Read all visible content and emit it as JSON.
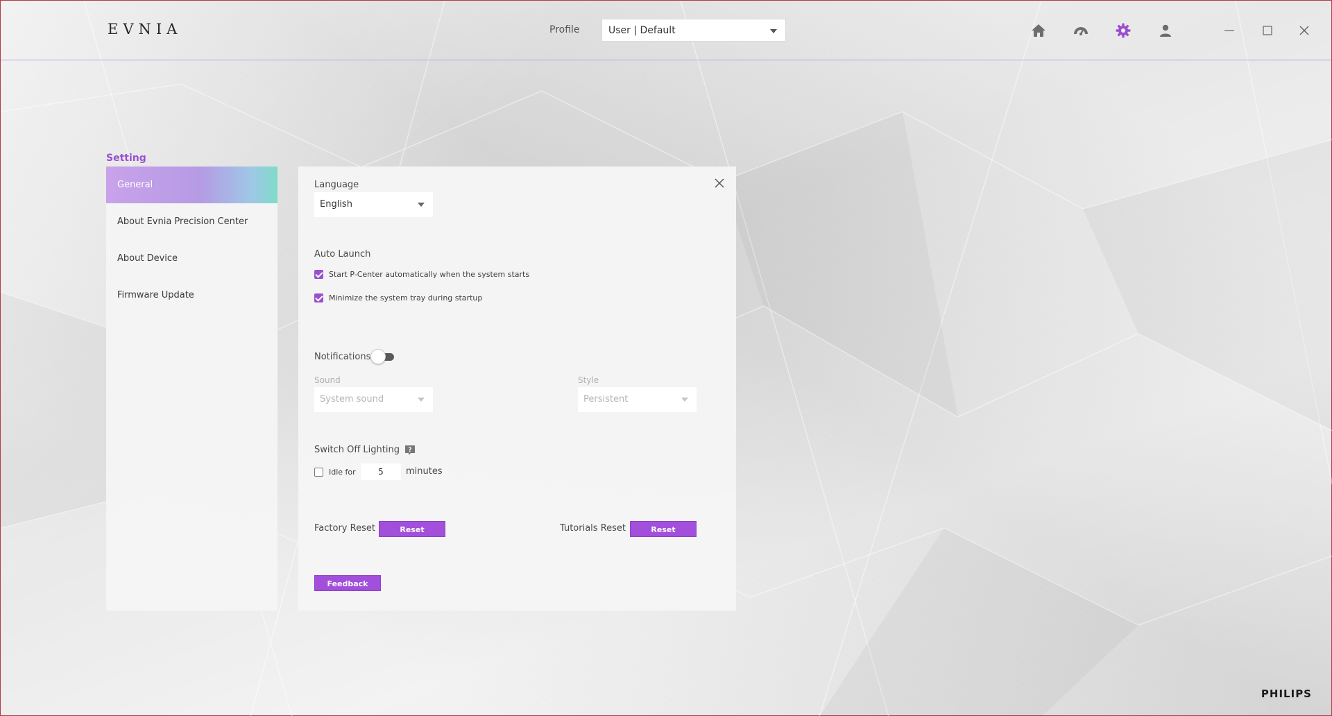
{
  "app": {
    "logo": "EVNIA",
    "brand": "PHILIPS"
  },
  "header": {
    "profile_label": "Profile",
    "profile_value": "User | Default",
    "nav_icons": [
      "home-icon",
      "dashboard-icon",
      "settings-icon",
      "user-icon"
    ],
    "active_nav": "settings-icon",
    "window_controls": [
      "minimize",
      "maximize",
      "close"
    ]
  },
  "sidebar": {
    "title": "Setting",
    "items": [
      {
        "label": "General",
        "active": true
      },
      {
        "label": "About Evnia Precision Center",
        "active": false
      },
      {
        "label": "About Device",
        "active": false
      },
      {
        "label": "Firmware Update",
        "active": false
      }
    ]
  },
  "panel": {
    "language": {
      "label": "Language",
      "value": "English"
    },
    "auto_launch": {
      "label": "Auto Launch",
      "options": [
        {
          "label": "Start P-Center automatically when the system starts",
          "checked": true
        },
        {
          "label": "Minimize the system tray during startup",
          "checked": true
        }
      ]
    },
    "notifications": {
      "label": "Notifications",
      "enabled": false,
      "sound_label": "Sound",
      "sound_value": "System sound",
      "style_label": "Style",
      "style_value": "Persistent"
    },
    "lighting": {
      "label": "Switch Off Lighting",
      "idle_label": "Idle for",
      "idle_value": "5",
      "idle_unit": "minutes",
      "idle_checked": false
    },
    "factory_reset": {
      "label": "Factory Reset",
      "button": "Reset"
    },
    "tutorials_reset": {
      "label": "Tutorials Reset",
      "button": "Reset"
    },
    "feedback_button": "Feedback"
  },
  "colors": {
    "accent": "#a24fdb",
    "title_purple": "#9b4fd0",
    "gradient_start": "#c9a2ea",
    "gradient_end": "#7fdcc9"
  }
}
